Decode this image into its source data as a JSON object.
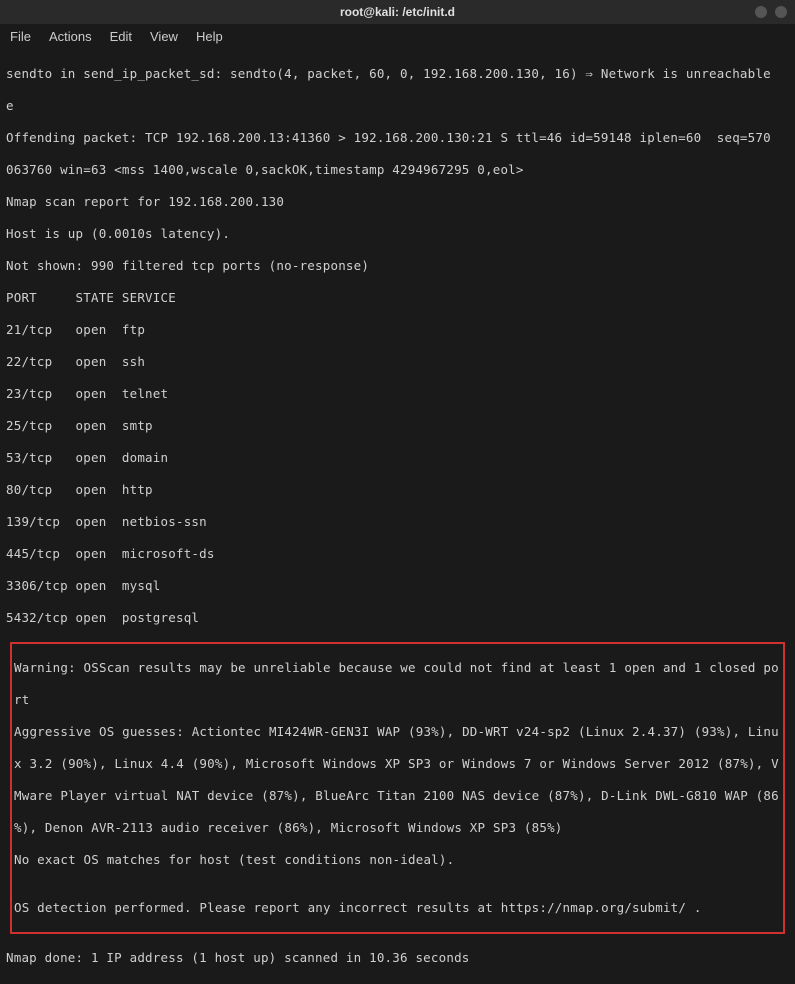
{
  "window": {
    "title": "root@kali: /etc/init.d"
  },
  "menu": {
    "file": "File",
    "actions": "Actions",
    "edit": "Edit",
    "view": "View",
    "help": "Help"
  },
  "terminal": {
    "lines": [
      "sendto in send_ip_packet_sd: sendto(4, packet, 60, 0, 192.168.200.130, 16) ⇒ Network is unreachable",
      "e",
      "Offending packet: TCP 192.168.200.13:41360 > 192.168.200.130:21 S ttl=46 id=59148 iplen=60  seq=570",
      "063760 win=63 <mss 1400,wscale 0,sackOK,timestamp 4294967295 0,eol>",
      "Nmap scan report for 192.168.200.130",
      "Host is up (0.0010s latency).",
      "Not shown: 990 filtered tcp ports (no-response)",
      "PORT     STATE SERVICE",
      "21/tcp   open  ftp",
      "22/tcp   open  ssh",
      "23/tcp   open  telnet",
      "25/tcp   open  smtp",
      "53/tcp   open  domain",
      "80/tcp   open  http",
      "139/tcp  open  netbios-ssn",
      "445/tcp  open  microsoft-ds",
      "3306/tcp open  mysql",
      "5432/tcp open  postgresql"
    ],
    "warning_lines": [
      "Warning: OSScan results may be unreliable because we could not find at least 1 open and 1 closed po",
      "rt",
      "Aggressive OS guesses: Actiontec MI424WR-GEN3I WAP (93%), DD-WRT v24-sp2 (Linux 2.4.37) (93%), Linu",
      "x 3.2 (90%), Linux 4.4 (90%), Microsoft Windows XP SP3 or Windows 7 or Windows Server 2012 (87%), V",
      "Mware Player virtual NAT device (87%), BlueArc Titan 2100 NAS device (87%), D-Link DWL-G810 WAP (86",
      "%), Denon AVR-2113 audio receiver (86%), Microsoft Windows XP SP3 (85%)",
      "No exact OS matches for host (test conditions non-ideal).",
      "",
      "OS detection performed. Please report any incorrect results at https://nmap.org/submit/ ."
    ],
    "footer_line": "Nmap done: 1 IP address (1 host up) scanned in 10.36 seconds"
  }
}
